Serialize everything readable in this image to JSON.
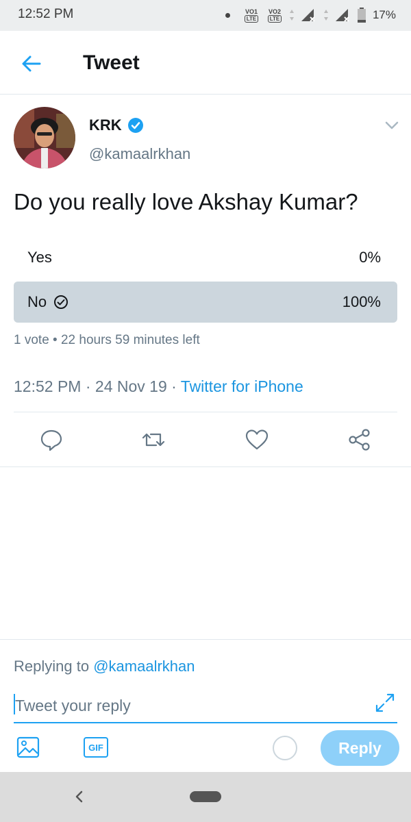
{
  "status_bar": {
    "time": "12:52 PM",
    "volte1": "VO",
    "volte1_num": "1",
    "volte2": "VO",
    "volte2_num": "2",
    "lte": "LTE",
    "battery": "17%"
  },
  "header": {
    "title": "Tweet"
  },
  "tweet": {
    "name": "KRK",
    "handle": "@kamaalrkhan",
    "text": "Do you really love Akshay Kumar?",
    "poll": {
      "options": [
        {
          "label": "Yes",
          "percent": "0%"
        },
        {
          "label": "No",
          "percent": "100%"
        }
      ],
      "meta": "1 vote • 22 hours 59 minutes left"
    },
    "time": "12:52 PM",
    "date": "24 Nov 19",
    "source": "Twitter for iPhone"
  },
  "composer": {
    "replying_prefix": "Replying to",
    "replying_handle": "@kamaalrkhan",
    "placeholder": "Tweet your reply",
    "gif_label": "GIF",
    "reply_label": "Reply"
  },
  "colors": {
    "accent": "#1da1f2",
    "link": "#1b95e0",
    "poll_selected": "#ccd6dd",
    "reply_disabled": "#8ed0f9"
  }
}
